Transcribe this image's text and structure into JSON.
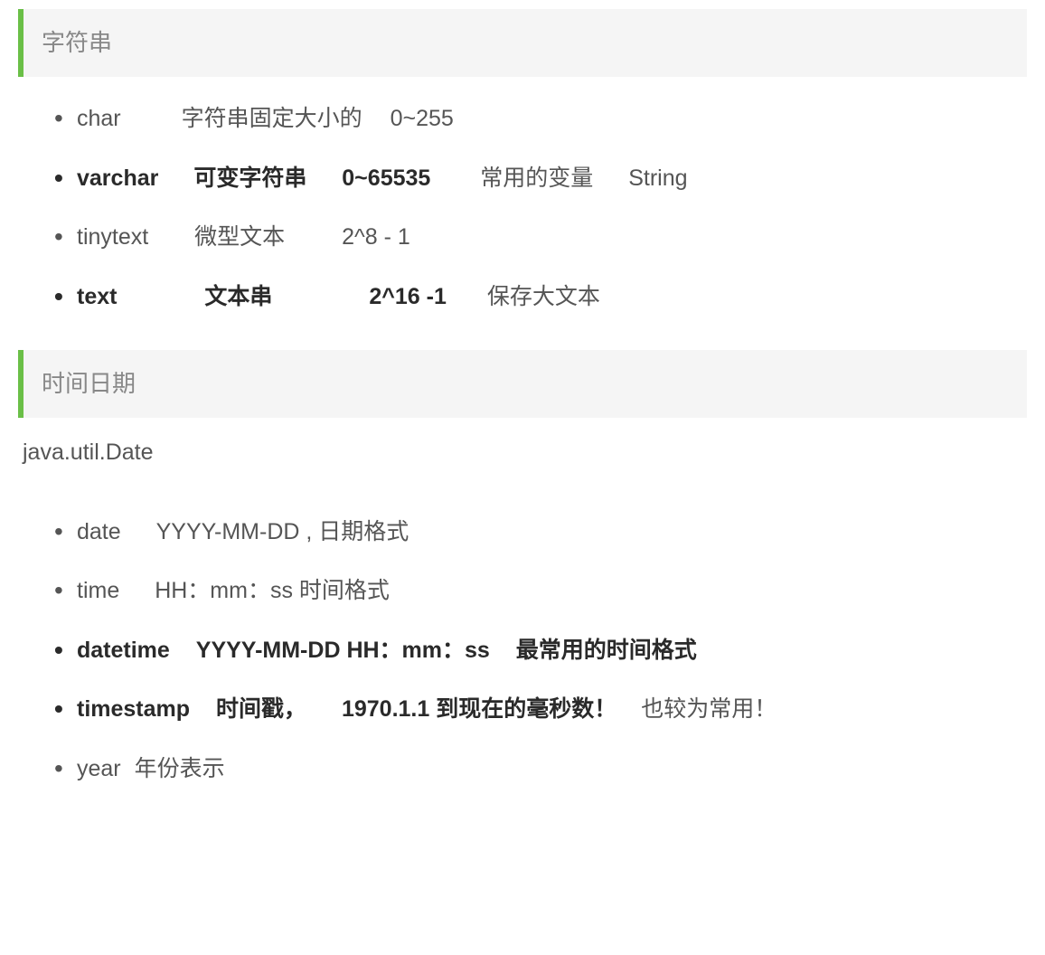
{
  "section1": {
    "title": "字符串",
    "items": [
      {
        "name": "char",
        "desc": "字符串固定大小的",
        "range": "0~255",
        "note": ""
      },
      {
        "name": "varchar",
        "desc": "可变字符串",
        "range": "0~65535",
        "note": "常用的变量",
        "extra": "String"
      },
      {
        "name": "tinytext",
        "desc": "微型文本",
        "range": "2^8 - 1",
        "note": ""
      },
      {
        "name": "text",
        "desc": "文本串",
        "range": "2^16 -1",
        "note": "保存大文本"
      }
    ]
  },
  "body_text": "java.util.Date",
  "section2": {
    "title": "时间日期",
    "items": [
      {
        "name": "date",
        "desc": "YYYY-MM-DD , 日期格式"
      },
      {
        "name": "time",
        "desc": "HH：mm：ss  时间格式"
      },
      {
        "name": "datetime",
        "desc": "YYYY-MM-DD HH：mm：ss",
        "note": "最常用的时间格式"
      },
      {
        "name": "timestamp",
        "desc": "时间戳，",
        "range": "1970.1.1 到现在的毫秒数！",
        "note": "也较为常用！"
      },
      {
        "name": "year",
        "desc": "年份表示"
      }
    ]
  }
}
